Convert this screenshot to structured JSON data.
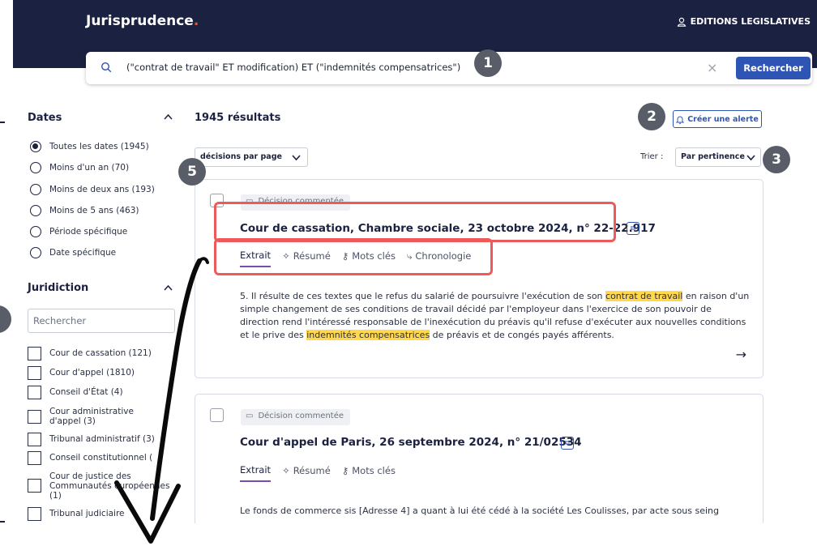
{
  "header": {
    "brand": "Jurisprudence",
    "brand_dot": ".",
    "account_label": "EDITIONS LEGISLATIVES"
  },
  "search": {
    "query": "(\"contrat de travail\" ET modification) ET (\"indemnités compensatrices\")",
    "clear_symbol": "×",
    "button_label": "Rechercher"
  },
  "badges": [
    "1",
    "2",
    "3",
    "5"
  ],
  "filters": {
    "dates": {
      "title": "Dates",
      "options": [
        {
          "label": "Toutes les dates (1945)",
          "selected": true
        },
        {
          "label": "Moins d'un an (70)",
          "selected": false
        },
        {
          "label": "Moins de deux ans (193)",
          "selected": false
        },
        {
          "label": "Moins de 5 ans (463)",
          "selected": false
        },
        {
          "label": "Période spécifique",
          "selected": false
        },
        {
          "label": "Date spécifique",
          "selected": false
        }
      ]
    },
    "jurisdiction": {
      "title": "Juridiction",
      "search_placeholder": "Rechercher",
      "options": [
        "Cour de cassation (121)",
        "Cour d'appel (1810)",
        "Conseil d'État (4)",
        "Cour administrative d'appel (3)",
        "Tribunal administratif (3)",
        "Conseil constitutionnel (",
        "Cour de justice des Communautés européennes (1)",
        "Tribunal judiciaire"
      ]
    }
  },
  "results": {
    "count_label": "1945 résultats",
    "alert_button": "Créer une alerte",
    "per_page_label": "décisions par page",
    "sort_label": "Trier :",
    "sort_value": "Par pertinence",
    "cards": [
      {
        "tag": "Décision commentée",
        "title": "Cour de cassation, Chambre sociale, 23 octobre 2024, n° 22-22.917",
        "tabs": [
          "Extrait",
          "Résumé",
          "Mots clés",
          "Chronologie"
        ],
        "excerpt_parts": [
          "5. Il résulte de ces textes que le refus du salarié de poursuivre l'exécution de son ",
          "contrat de travail",
          " en raison d'un simple changement de ses conditions de travail décidé par l'employeur dans l'exercice de son pouvoir de direction rend l'intéressé responsable de l'inexécution du préavis qu'il refuse d'exécuter aux nouvelles conditions et le prive des ",
          "indemnités compensatrices",
          " de préavis et de congés payés afférents."
        ]
      },
      {
        "tag": "Décision commentée",
        "title": "Cour d'appel de Paris, 26 septembre 2024, n° 21/02534",
        "tabs": [
          "Extrait",
          "Résumé",
          "Mots clés"
        ],
        "excerpt": "Le fonds de commerce sis [Adresse 4] a quant à lui été cédé à la société Les Coulisses, par acte sous seing"
      }
    ]
  },
  "colors": {
    "header_bg": "#1b2140",
    "primary": "#2f55b4",
    "highlight": "#ffd84d",
    "annotation_red": "#ee5a5a",
    "badge_gray": "#595d68"
  }
}
